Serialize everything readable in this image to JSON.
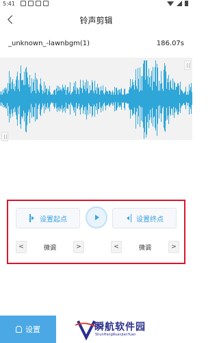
{
  "status_bar": {
    "time": "5:41"
  },
  "header": {
    "title": "铃声剪辑"
  },
  "audio": {
    "file_name": "_unknown_-lawnbgm(1)",
    "duration": "186.07s"
  },
  "controls": {
    "set_start_label": "设置起点",
    "set_end_label": "设置终点",
    "fine_tune_label": "微调",
    "dec_glyph": "<",
    "inc_glyph": ">"
  },
  "footer": {
    "settings_label": "设置"
  },
  "watermark": {
    "title": "瞬航软件园",
    "subtitle": "ShunHangRuanJianYuan"
  },
  "colors": {
    "accent": "#3aa2e0",
    "waveform": "#2fa6d8",
    "highlight_border": "#d9142b"
  }
}
